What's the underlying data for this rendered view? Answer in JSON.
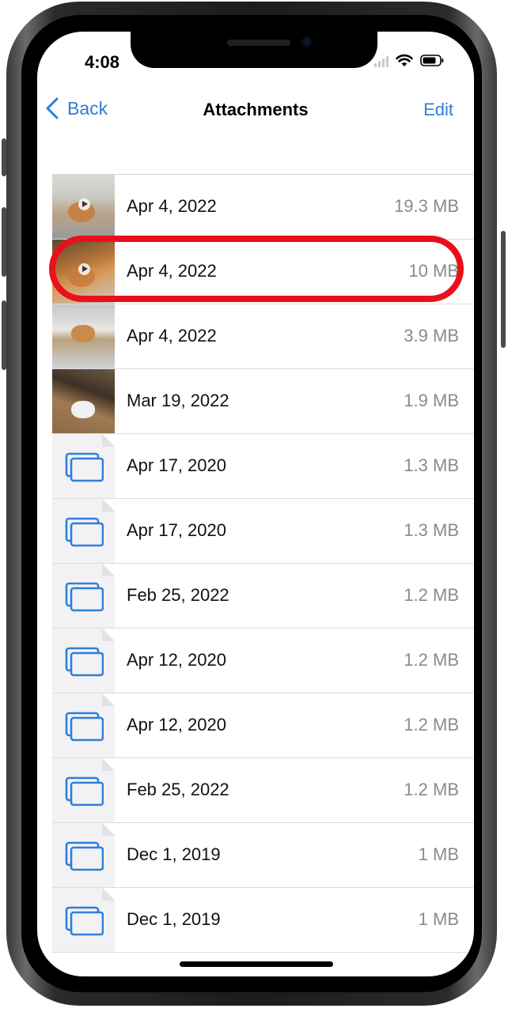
{
  "status_bar": {
    "time": "4:08"
  },
  "nav": {
    "back_label": "Back",
    "title": "Attachments",
    "edit_label": "Edit"
  },
  "colors": {
    "accent": "#2f7ed8",
    "highlight": "#e8101b",
    "secondary_text": "#8a8a8e"
  },
  "attachments": [
    {
      "date": "Apr 4, 2022",
      "size": "19.3 MB",
      "kind": "video"
    },
    {
      "date": "Apr 4, 2022",
      "size": "10 MB",
      "kind": "video",
      "highlighted": true
    },
    {
      "date": "Apr 4, 2022",
      "size": "3.9 MB",
      "kind": "photo"
    },
    {
      "date": "Mar 19, 2022",
      "size": "1.9 MB",
      "kind": "photo"
    },
    {
      "date": "Apr 17, 2020",
      "size": "1.3 MB",
      "kind": "file"
    },
    {
      "date": "Apr 17, 2020",
      "size": "1.3 MB",
      "kind": "file"
    },
    {
      "date": "Feb 25, 2022",
      "size": "1.2 MB",
      "kind": "file"
    },
    {
      "date": "Apr 12, 2020",
      "size": "1.2 MB",
      "kind": "file"
    },
    {
      "date": "Apr 12, 2020",
      "size": "1.2 MB",
      "kind": "file"
    },
    {
      "date": "Feb 25, 2022",
      "size": "1.2 MB",
      "kind": "file"
    },
    {
      "date": "Dec 1, 2019",
      "size": "1 MB",
      "kind": "file"
    },
    {
      "date": "Dec 1, 2019",
      "size": "1 MB",
      "kind": "file"
    }
  ]
}
